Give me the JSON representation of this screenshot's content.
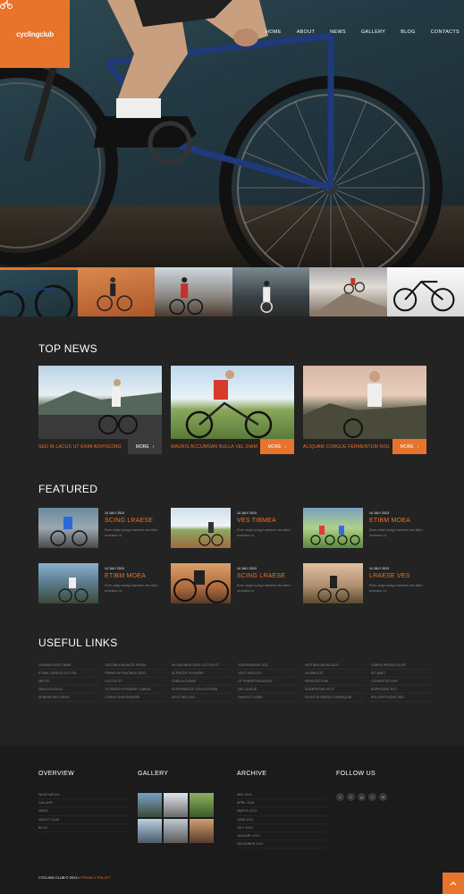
{
  "brand": {
    "logo_text": "cyclingclub",
    "accent": "#e8732a"
  },
  "nav": {
    "items": [
      "HOME",
      "ABOUT",
      "NEWS",
      "GALLERY",
      "BLOG",
      "CONTACTS"
    ]
  },
  "sections": {
    "top_news": "TOP NEWS",
    "featured": "FEATURED",
    "useful_links": "USEFUL LINKS"
  },
  "top_news": [
    {
      "caption": "SED IN LACUS UT ENIM ADIPISCING",
      "more": "MORE"
    },
    {
      "caption": "MAURIS ACCUMSAN NULLA VEL DIAM",
      "more": "MORE"
    },
    {
      "caption": "ALIQUAM CONGUE FERMENTUM NISL",
      "more": "MORE"
    }
  ],
  "featured": [
    {
      "date": "14 JULY 2013",
      "title": "SCING LRAESE",
      "desc": "Ever adipi scing lraesent ves tibm moeacn ro."
    },
    {
      "date": "14 JULY 2013",
      "title": "VES TIBMEA",
      "desc": "Ever adipi scing lraesent ves tibm moeacn ro."
    },
    {
      "date": "14 JULY 2013",
      "title": "ETIBM MOEA",
      "desc": "Ever adipi scing lraesent ves tibm moeacn ro."
    },
    {
      "date": "14 JULY 2013",
      "title": "ETIBM MOEA",
      "desc": "Ever adipi scing lraesent ves tibm moeacn ro."
    },
    {
      "date": "14 JULY 2013",
      "title": "SCING LRAESE",
      "desc": "Ever adipi scing lraesent ves tibm moeacn ro."
    },
    {
      "date": "14 JULY 2013",
      "title": "LRAESE VES",
      "desc": "Ever adipi scing lraesent ves tibm moeacn ro."
    }
  ],
  "useful_links": [
    [
      "VIVAMUS EGET NIBH",
      "ETIAM CURSUS LEO VEL",
      "METUS",
      "NULLA FACILISI",
      "AENEAN NEC EROS"
    ],
    [
      "VESTIBULUM ANTE IPSUM",
      "PRIMIS IN FAUCIBUS ORCI",
      "LUCTUS ET",
      "ULTRICES POSUERE CUBILIA",
      "CURAE SUSPENDISSE"
    ],
    [
      "IN FAUCIBUS ORCI LUCTUS ET",
      "ULTRICES POSUERE",
      "CUBILIA CURAE",
      "SUSPENDISSE SOLLICITUDIN",
      "VELIT SED LEO"
    ],
    [
      "SUSPENDISSE SOL",
      "VELIT SED LEO",
      "UT PHARETRA AUGUE",
      "NEC AUGUE",
      "NAM ELIT AGNA"
    ],
    [
      "VESTIBULUM IACULIS",
      "LACINIA EST",
      "PROIN DICTUM",
      "ELEMENTUM VELIT",
      "FUSCE EUISMOD CONSEQUAT"
    ],
    [
      "LOREM IPSUM DOLOR",
      "SIT AMET",
      "CONSECTETUER",
      "ADIPISCING ELIT",
      "PELLENTESQUE SED"
    ]
  ],
  "footer": {
    "overview_title": "OVERVIEW",
    "overview_items": [
      "WHAT WE DO",
      "GALLERY",
      "NEWS",
      "ABOUT CLUB",
      "BLOG"
    ],
    "gallery_title": "GALLERY",
    "archive_title": "ARCHIVE",
    "archive_items": [
      "MAY 2013",
      "APRIL 2013",
      "MARCH 2013",
      "JUNE 2013",
      "JULY 2013",
      "JANUARY 2013",
      "DECEMBER 2013"
    ],
    "follow_title": "FOLLOW US",
    "social": [
      "twitter-icon",
      "facebook-icon",
      "google-plus-icon",
      "rss-icon",
      "linkedin-icon"
    ],
    "social_glyphs": [
      "t",
      "f",
      "g",
      "r",
      "in"
    ],
    "copyright": "CYCLING CLUB © 2013 •",
    "privacy": "PRIVACY POLICY"
  }
}
